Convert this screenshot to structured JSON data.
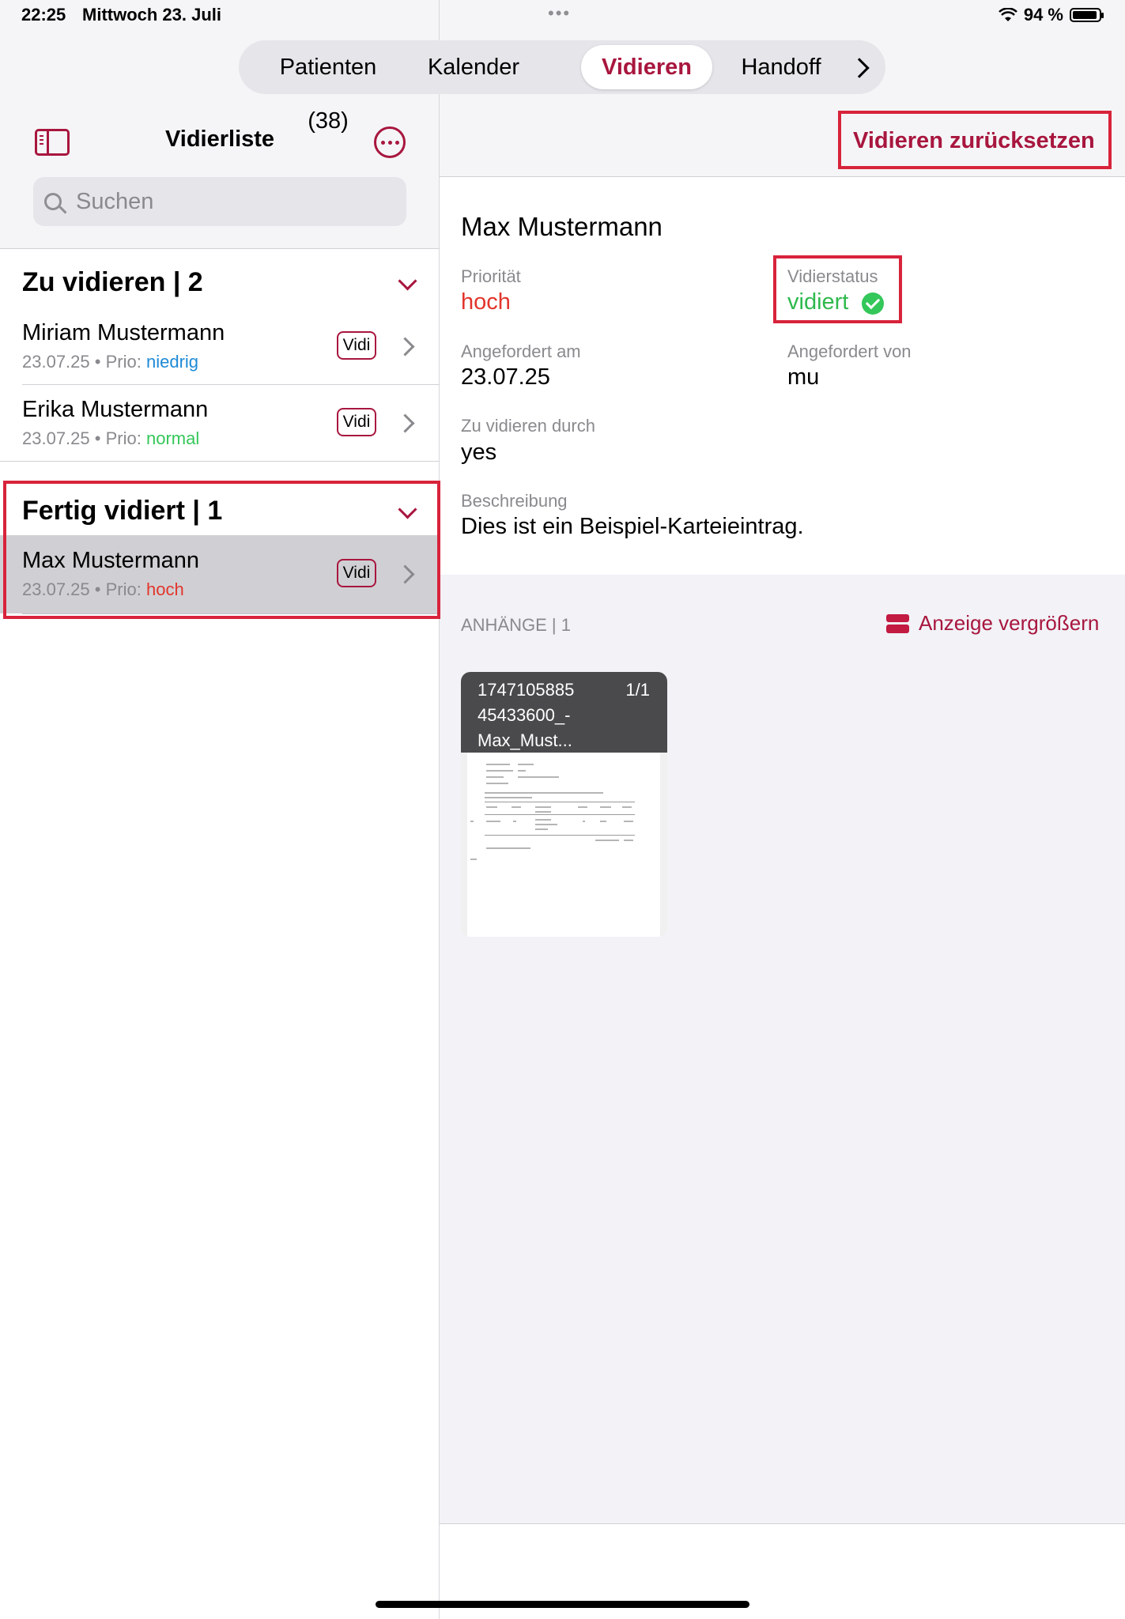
{
  "status_bar": {
    "time": "22:25",
    "date": "Mittwoch 23. Juli",
    "battery": "94 %",
    "battery_level": 0.94,
    "dots": "•••"
  },
  "tabs": {
    "items": [
      {
        "label": "Patienten (38)",
        "active": false
      },
      {
        "label": "Kalender",
        "active": false
      },
      {
        "label": "Vidieren",
        "active": true
      },
      {
        "label": "Handoff",
        "active": false
      }
    ]
  },
  "sidebar": {
    "title": "Vidierliste",
    "search_placeholder": "Suchen",
    "sections": [
      {
        "title": "Zu vidieren | 2",
        "rows": [
          {
            "name": "Miriam Mustermann",
            "date": "23.07.25",
            "prio_label": "Prio:",
            "prio": "niedrig",
            "prio_color": "#1e8ad6",
            "badge": "Vidi",
            "bullet": "•"
          },
          {
            "name": "Erika Mustermann",
            "date": "23.07.25",
            "prio_label": "Prio:",
            "prio": "normal",
            "prio_color": "#34c759",
            "badge": "Vidi",
            "bullet": "•"
          }
        ]
      },
      {
        "title": "Fertig vidiert | 1",
        "rows": [
          {
            "name": "Max Mustermann",
            "date": "23.07.25",
            "prio_label": "Prio:",
            "prio": "hoch",
            "prio_color": "#e2352c",
            "badge": "Vidi",
            "bullet": "•",
            "selected": true
          }
        ]
      }
    ]
  },
  "detail": {
    "reset_button": "Vidieren zurücksetzen",
    "name": "Max Mustermann",
    "priority_label": "Priorität",
    "priority_value": "hoch",
    "status_label": "Vidierstatus",
    "status_value": "vidiert",
    "requested_on_label": "Angefordert am",
    "requested_on_value": "23.07.25",
    "requested_by_label": "Angefordert von",
    "requested_by_value": "mu",
    "to_verify_by_label": "Zu vidieren durch",
    "to_verify_by_value": "yes",
    "description_label": "Beschreibung",
    "description_value": "Dies ist ein Beispiel-Karteieintrag."
  },
  "attachments": {
    "title": "ANHÄNGE | 1",
    "enlarge_label": "Anzeige vergrößern",
    "items": [
      {
        "filename": "1747105885\n45433600_-\nMax_Must...",
        "pages": "1/1"
      }
    ]
  },
  "colors": {
    "accent": "#a8163e",
    "highlight_box": "#d8233b",
    "green": "#34c759",
    "red": "#e2352c"
  }
}
